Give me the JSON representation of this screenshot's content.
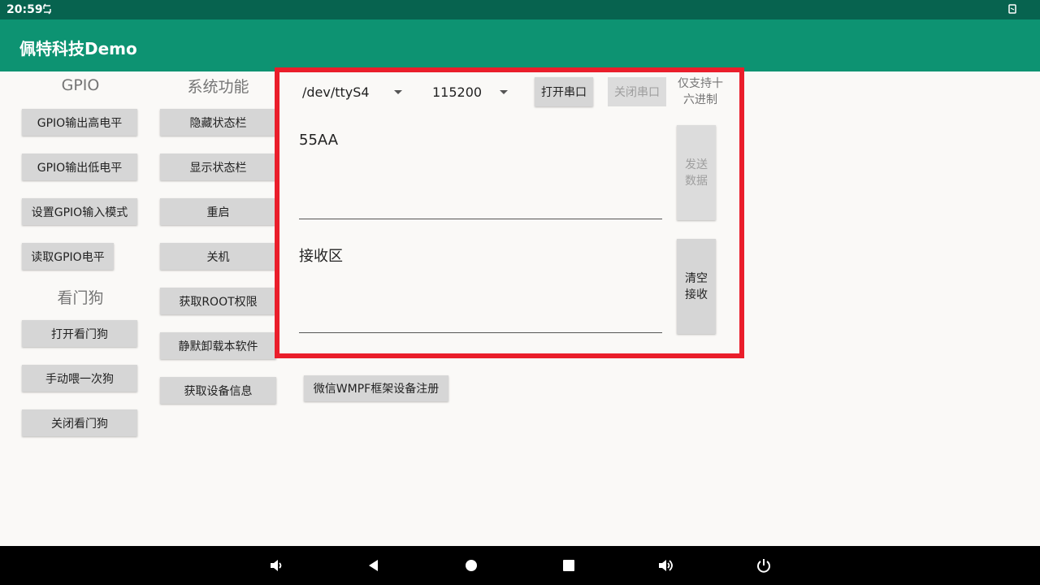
{
  "status_bar": {
    "time": "20:59"
  },
  "app_bar": {
    "title": "佩特科技Demo"
  },
  "gpio": {
    "heading": "GPIO",
    "buttons": [
      "GPIO输出高电平",
      "GPIO输出低电平",
      "设置GPIO输入模式",
      "读取GPIO电平"
    ]
  },
  "watchdog": {
    "heading": "看门狗",
    "buttons": [
      "打开看门狗",
      "手动喂一次狗",
      "关闭看门狗"
    ]
  },
  "system": {
    "heading": "系统功能",
    "buttons": [
      "隐藏状态栏",
      "显示状态栏",
      "重启",
      "关机",
      "获取ROOT权限",
      "静默卸载本软件",
      "获取设备信息"
    ]
  },
  "serial": {
    "port_value": "/dev/ttyS4",
    "baud_value": "115200",
    "open_button": "打开串口",
    "close_button": "关闭串口",
    "hex_hint_line1": "仅支持十",
    "hex_hint_line2": "六进制",
    "send_input_value": "55AA",
    "send_button_line1": "发送",
    "send_button_line2": "数据",
    "receive_value": "接收区",
    "clear_button_line1": "清空",
    "clear_button_line2": "接收"
  },
  "wmpf_button": "微信WMPF框架设备注册",
  "colors": {
    "status_bar": "#07634f",
    "app_bar": "#0d9372",
    "highlight": "#ea1e2b"
  },
  "nav_icons": [
    "volume-down-icon",
    "back-icon",
    "home-icon",
    "recents-icon",
    "volume-up-icon",
    "power-icon"
  ]
}
